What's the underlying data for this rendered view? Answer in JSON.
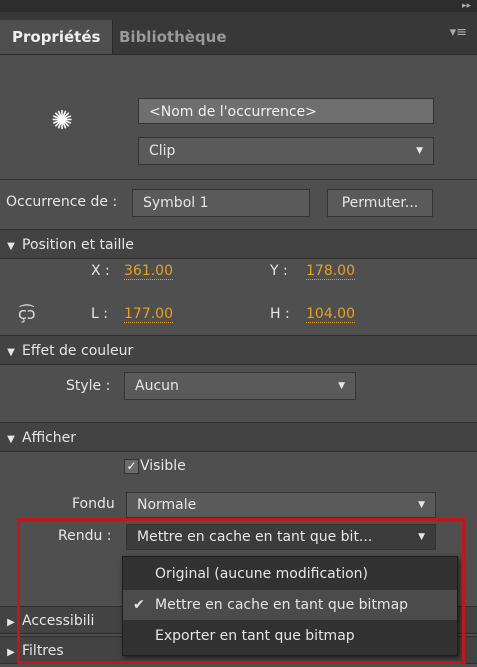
{
  "panel": {
    "tabs": [
      {
        "label": "Propriétés"
      },
      {
        "label": "Bibliothèque"
      }
    ],
    "collapse_icon": "double-chevron-right-icon",
    "menu_icon": "panel-menu-icon"
  },
  "instance": {
    "name_placeholder": "<Nom de l'occurrence>",
    "type_value": "Clip",
    "symbol_icon": "movieclip-symbol-icon"
  },
  "occurrence": {
    "label": "Occurrence de :",
    "value": "Symbol 1",
    "swap_button": "Permuter..."
  },
  "position": {
    "header": "Position et taille",
    "x_label": "X :",
    "x_value": "361.00",
    "y_label": "Y :",
    "y_value": "178.00",
    "w_label": "L :",
    "w_value": "177.00",
    "h_label": "H :",
    "h_value": "104.00",
    "link_icon": "chain-link-icon"
  },
  "color_effect": {
    "header": "Effet de couleur",
    "style_label": "Style :",
    "style_value": "Aucun"
  },
  "display": {
    "header": "Afficher",
    "visible_label": "Visible",
    "visible_checked": "✓",
    "blend_label": "Fondu",
    "blend_value": "Normale",
    "render_label": "Rendu :",
    "render_value": "Mettre en cache en tant que bit..."
  },
  "render_menu": {
    "items": [
      {
        "label": "Original (aucune modification)",
        "checked": ""
      },
      {
        "label": "Mettre en cache en tant que bitmap",
        "checked": "✔"
      },
      {
        "label": "Exporter en tant que bitmap",
        "checked": ""
      }
    ]
  },
  "collapsed_sections": {
    "accessibility": "Accessibili",
    "filters": "Filtres"
  },
  "colors": {
    "panel_bg": "#4f4f4f",
    "hot_value": "#e6a020",
    "highlight_border": "#c01818"
  }
}
